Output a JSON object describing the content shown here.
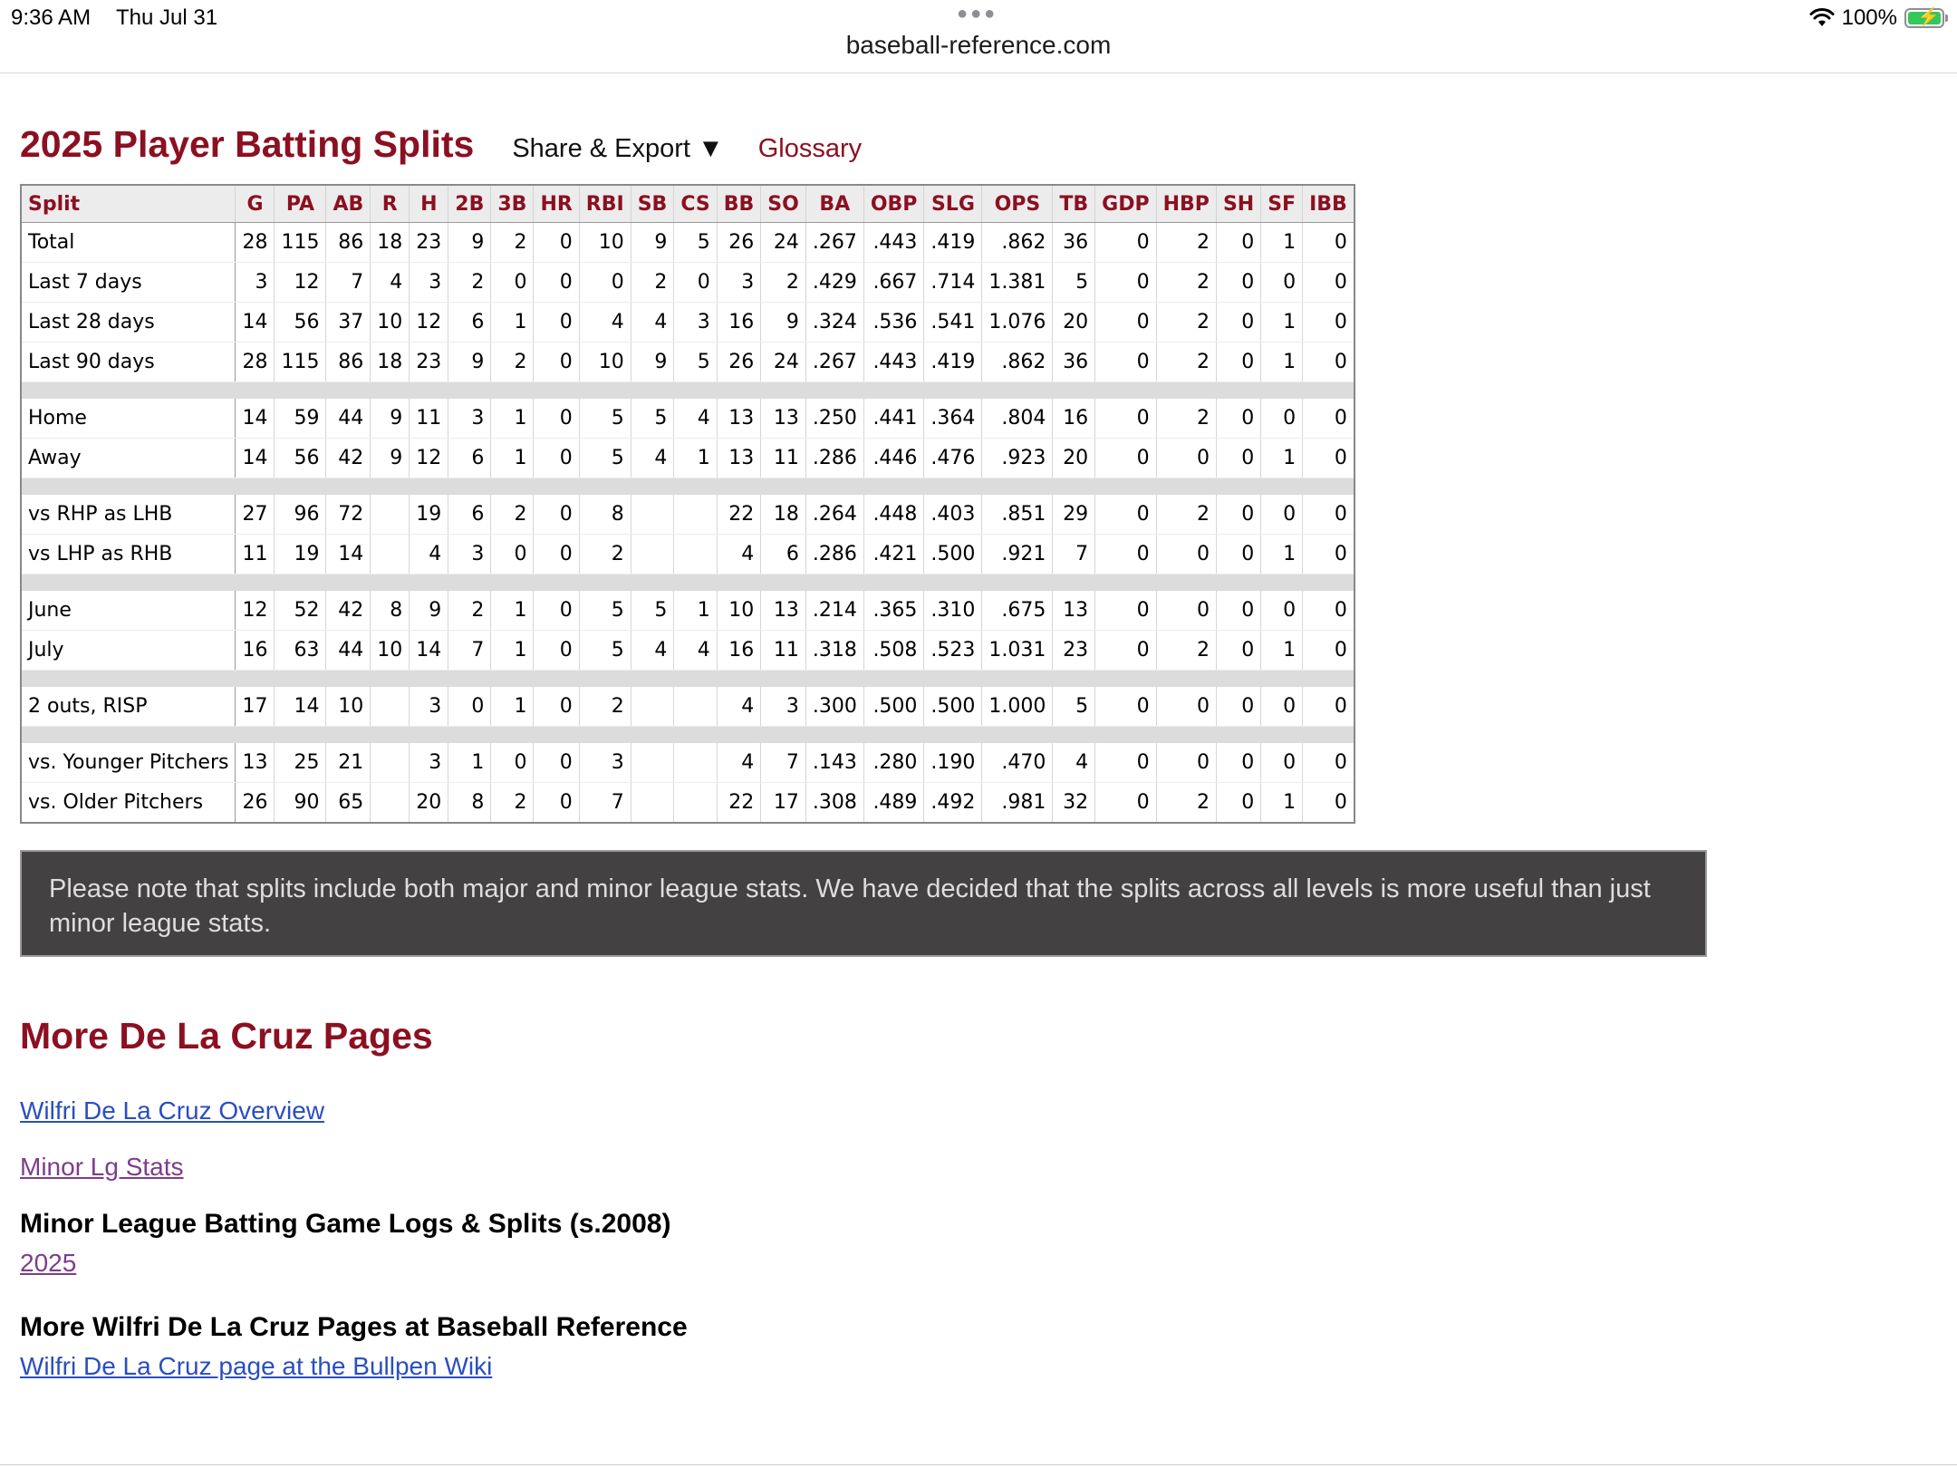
{
  "status": {
    "time": "9:36 AM",
    "date": "Thu Jul 31",
    "battery": "100%",
    "url": "baseball-reference.com"
  },
  "header": {
    "title": "2025 Player Batting Splits",
    "share": "Share & Export ▼",
    "glossary": "Glossary"
  },
  "table": {
    "columns": [
      "Split",
      "G",
      "PA",
      "AB",
      "R",
      "H",
      "2B",
      "3B",
      "HR",
      "RBI",
      "SB",
      "CS",
      "BB",
      "SO",
      "BA",
      "OBP",
      "SLG",
      "OPS",
      "TB",
      "GDP",
      "HBP",
      "SH",
      "SF",
      "IBB"
    ],
    "groups": [
      [
        [
          "Total",
          "28",
          "115",
          "86",
          "18",
          "23",
          "9",
          "2",
          "0",
          "10",
          "9",
          "5",
          "26",
          "24",
          ".267",
          ".443",
          ".419",
          ".862",
          "36",
          "0",
          "2",
          "0",
          "1",
          "0"
        ],
        [
          "Last 7 days",
          "3",
          "12",
          "7",
          "4",
          "3",
          "2",
          "0",
          "0",
          "0",
          "2",
          "0",
          "3",
          "2",
          ".429",
          ".667",
          ".714",
          "1.381",
          "5",
          "0",
          "2",
          "0",
          "0",
          "0"
        ],
        [
          "Last 28 days",
          "14",
          "56",
          "37",
          "10",
          "12",
          "6",
          "1",
          "0",
          "4",
          "4",
          "3",
          "16",
          "9",
          ".324",
          ".536",
          ".541",
          "1.076",
          "20",
          "0",
          "2",
          "0",
          "1",
          "0"
        ],
        [
          "Last 90 days",
          "28",
          "115",
          "86",
          "18",
          "23",
          "9",
          "2",
          "0",
          "10",
          "9",
          "5",
          "26",
          "24",
          ".267",
          ".443",
          ".419",
          ".862",
          "36",
          "0",
          "2",
          "0",
          "1",
          "0"
        ]
      ],
      [
        [
          "Home",
          "14",
          "59",
          "44",
          "9",
          "11",
          "3",
          "1",
          "0",
          "5",
          "5",
          "4",
          "13",
          "13",
          ".250",
          ".441",
          ".364",
          ".804",
          "16",
          "0",
          "2",
          "0",
          "0",
          "0"
        ],
        [
          "Away",
          "14",
          "56",
          "42",
          "9",
          "12",
          "6",
          "1",
          "0",
          "5",
          "4",
          "1",
          "13",
          "11",
          ".286",
          ".446",
          ".476",
          ".923",
          "20",
          "0",
          "0",
          "0",
          "1",
          "0"
        ]
      ],
      [
        [
          "vs RHP as LHB",
          "27",
          "96",
          "72",
          "",
          "19",
          "6",
          "2",
          "0",
          "8",
          "",
          "",
          "22",
          "18",
          ".264",
          ".448",
          ".403",
          ".851",
          "29",
          "0",
          "2",
          "0",
          "0",
          "0"
        ],
        [
          "vs LHP as RHB",
          "11",
          "19",
          "14",
          "",
          "4",
          "3",
          "0",
          "0",
          "2",
          "",
          "",
          "4",
          "6",
          ".286",
          ".421",
          ".500",
          ".921",
          "7",
          "0",
          "0",
          "0",
          "1",
          "0"
        ]
      ],
      [
        [
          "June",
          "12",
          "52",
          "42",
          "8",
          "9",
          "2",
          "1",
          "0",
          "5",
          "5",
          "1",
          "10",
          "13",
          ".214",
          ".365",
          ".310",
          ".675",
          "13",
          "0",
          "0",
          "0",
          "0",
          "0"
        ],
        [
          "July",
          "16",
          "63",
          "44",
          "10",
          "14",
          "7",
          "1",
          "0",
          "5",
          "4",
          "4",
          "16",
          "11",
          ".318",
          ".508",
          ".523",
          "1.031",
          "23",
          "0",
          "2",
          "0",
          "1",
          "0"
        ]
      ],
      [
        [
          "2 outs, RISP",
          "17",
          "14",
          "10",
          "",
          "3",
          "0",
          "1",
          "0",
          "2",
          "",
          "",
          "4",
          "3",
          ".300",
          ".500",
          ".500",
          "1.000",
          "5",
          "0",
          "0",
          "0",
          "0",
          "0"
        ]
      ],
      [
        [
          "vs. Younger Pitchers",
          "13",
          "25",
          "21",
          "",
          "3",
          "1",
          "0",
          "0",
          "3",
          "",
          "",
          "4",
          "7",
          ".143",
          ".280",
          ".190",
          ".470",
          "4",
          "0",
          "0",
          "0",
          "0",
          "0"
        ],
        [
          "vs. Older Pitchers",
          "26",
          "90",
          "65",
          "",
          "20",
          "8",
          "2",
          "0",
          "7",
          "",
          "",
          "22",
          "17",
          ".308",
          ".489",
          ".492",
          ".981",
          "32",
          "0",
          "2",
          "0",
          "1",
          "0"
        ]
      ]
    ]
  },
  "note": "Please note that splits include both major and minor league stats. We have decided that the splits across all levels is more useful than just minor league stats.",
  "more": {
    "title": "More De La Cruz Pages",
    "overview": "Wilfri De La Cruz Overview",
    "minor_stats": "Minor Lg Stats",
    "logs_heading": "Minor League Batting Game Logs & Splits (s.2008)",
    "year": "2025",
    "br_heading": "More Wilfri De La Cruz Pages at Baseball Reference",
    "bullpen": "Wilfri De La Cruz page at the Bullpen Wiki"
  }
}
